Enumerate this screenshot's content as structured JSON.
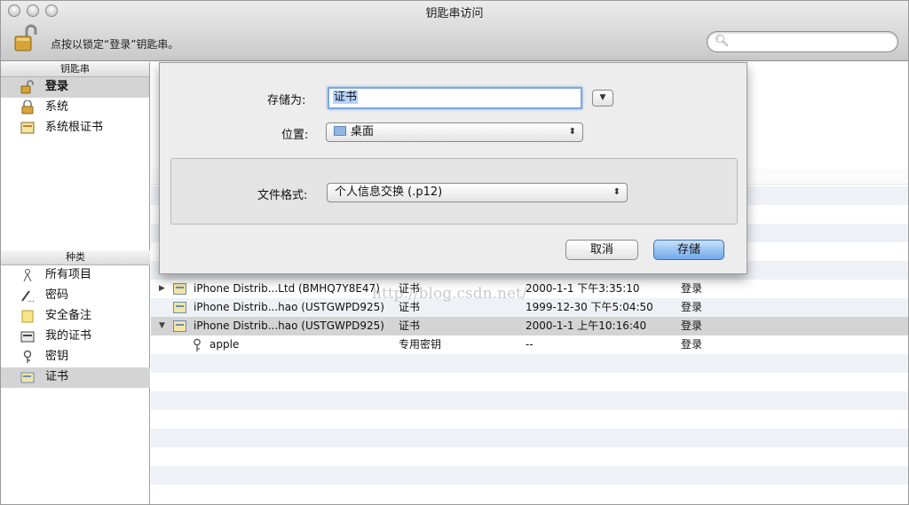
{
  "window": {
    "title": "钥匙串访问"
  },
  "toolbar": {
    "lock_text": "点按以锁定“登录”钥匙串。",
    "search_placeholder": ""
  },
  "sidebar": {
    "keychains_header": "钥匙串",
    "keychains": [
      {
        "label": "登录",
        "icon": "open-lock-icon",
        "selected": true
      },
      {
        "label": "系统",
        "icon": "lock-icon",
        "selected": false
      },
      {
        "label": "系统根证书",
        "icon": "cert-folder-icon",
        "selected": false
      }
    ],
    "category_header": "种类",
    "categories": [
      {
        "label": "所有项目",
        "icon": "all-items-icon",
        "selected": false
      },
      {
        "label": "密码",
        "icon": "password-icon",
        "selected": false
      },
      {
        "label": "安全备注",
        "icon": "secure-note-icon",
        "selected": false
      },
      {
        "label": "我的证书",
        "icon": "my-cert-icon",
        "selected": false
      },
      {
        "label": "密钥",
        "icon": "key-icon",
        "selected": false
      },
      {
        "label": "证书",
        "icon": "certificate-icon",
        "selected": true
      }
    ]
  },
  "list": {
    "rows": [
      {
        "name": "iPhone Distrib...Ltd (BMHQ7Y8E47)",
        "kind": "证书",
        "date": "2000-1-1 下午3:35:10",
        "keychain": "登录",
        "expand": "▶"
      },
      {
        "name": "iPhone Distrib...hao (USTGWPD925)",
        "kind": "证书",
        "date": "1999-12-30 下午5:04:50",
        "keychain": "登录",
        "expand": ""
      },
      {
        "name": "iPhone Distrib...hao (USTGWPD925)",
        "kind": "证书",
        "date": "2000-1-1 上午10:16:40",
        "keychain": "登录",
        "expand": "▼"
      },
      {
        "name": "apple",
        "kind": "专用密钥",
        "date": "--",
        "keychain": "登录",
        "expand": ""
      }
    ]
  },
  "sheet": {
    "save_as_label": "存储为:",
    "save_as_value": "证书",
    "location_label": "位置:",
    "location_value": "桌面",
    "format_label": "文件格式:",
    "format_value": "个人信息交换 (.p12)",
    "cancel_label": "取消",
    "save_label": "存储"
  },
  "watermark": "http://blog.csdn.net/"
}
